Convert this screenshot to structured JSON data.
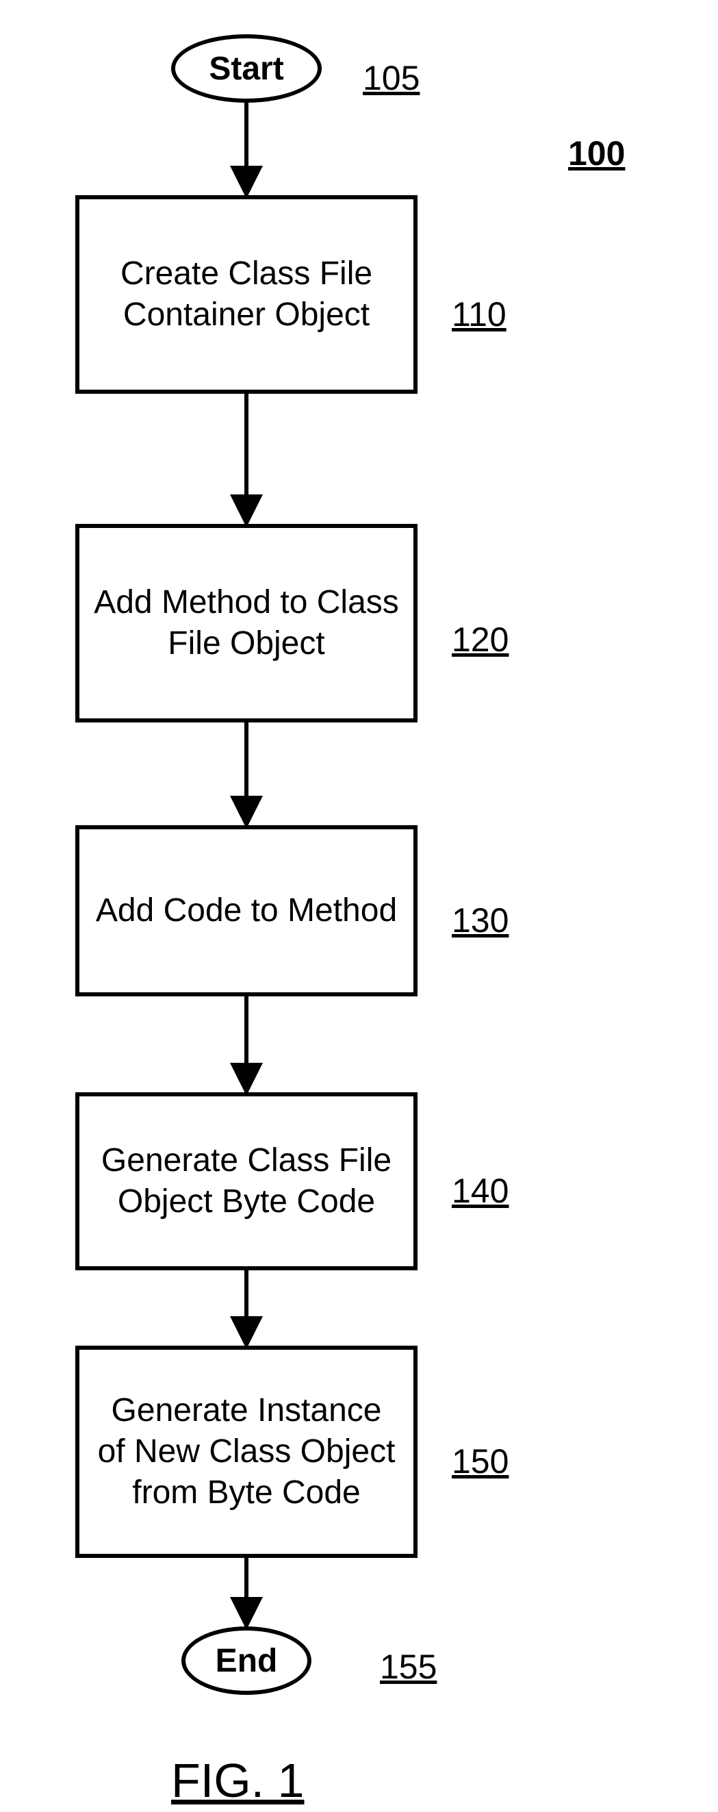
{
  "diagram": {
    "title_ref": "100",
    "start": {
      "label": "Start",
      "ref": "105"
    },
    "steps": [
      {
        "text": "Create Class File Container Object",
        "ref": "110"
      },
      {
        "text": "Add Method to Class File Object",
        "ref": "120"
      },
      {
        "text": "Add Code to Method",
        "ref": "130"
      },
      {
        "text": "Generate Class File Object Byte Code",
        "ref": "140"
      },
      {
        "text": "Generate Instance of New Class Object from Byte Code",
        "ref": "150"
      }
    ],
    "end": {
      "label": "End",
      "ref": "155"
    },
    "figure_caption": "FIG. 1"
  }
}
